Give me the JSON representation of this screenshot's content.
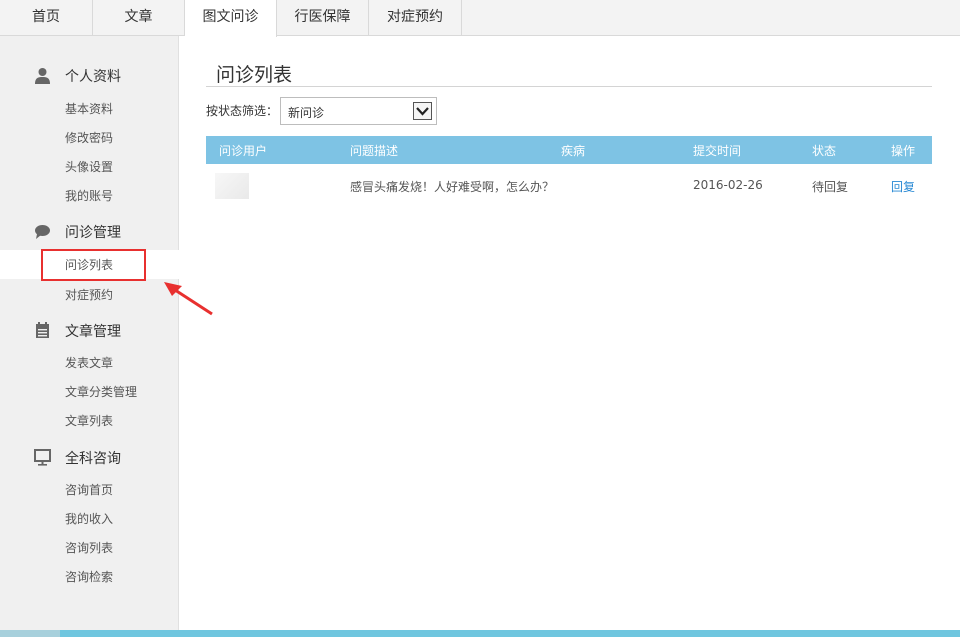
{
  "topnav": {
    "tabs": [
      {
        "label": "首页"
      },
      {
        "label": "文章"
      },
      {
        "label": "图文问诊",
        "active": true
      },
      {
        "label": "行医保障"
      },
      {
        "label": "对症预约"
      }
    ]
  },
  "sidebar": {
    "groups": [
      {
        "label": "个人资料",
        "icon": "person-icon",
        "items": [
          "基本资料",
          "修改密码",
          "头像设置",
          "我的账号"
        ]
      },
      {
        "label": "问诊管理",
        "icon": "chat-bubble-icon",
        "items": [
          "问诊列表",
          "对症预约"
        ],
        "active_item": "问诊列表"
      },
      {
        "label": "文章管理",
        "icon": "notepad-icon",
        "items": [
          "发表文章",
          "文章分类管理",
          "文章列表"
        ]
      },
      {
        "label": "全科咨询",
        "icon": "monitor-icon",
        "items": [
          "咨询首页",
          "我的收入",
          "咨询列表",
          "咨询检索"
        ]
      }
    ]
  },
  "main": {
    "title": "问诊列表",
    "filter": {
      "label": "按状态筛选：",
      "selected": "新问诊"
    },
    "table": {
      "headers": [
        "问诊用户",
        "问题描述",
        "疾病",
        "提交时间",
        "状态",
        "操作"
      ],
      "rows": [
        {
          "description": "感冒头痛发烧！人好难受啊，怎么办？",
          "disease": "",
          "date": "2016-02-26",
          "status": "待回复",
          "action": "回复"
        }
      ]
    }
  },
  "colors": {
    "table_header": "#7ec3e4",
    "link": "#2a8ad4",
    "highlight": "#e8302f",
    "sidebar_bg": "#f0f0f0"
  }
}
